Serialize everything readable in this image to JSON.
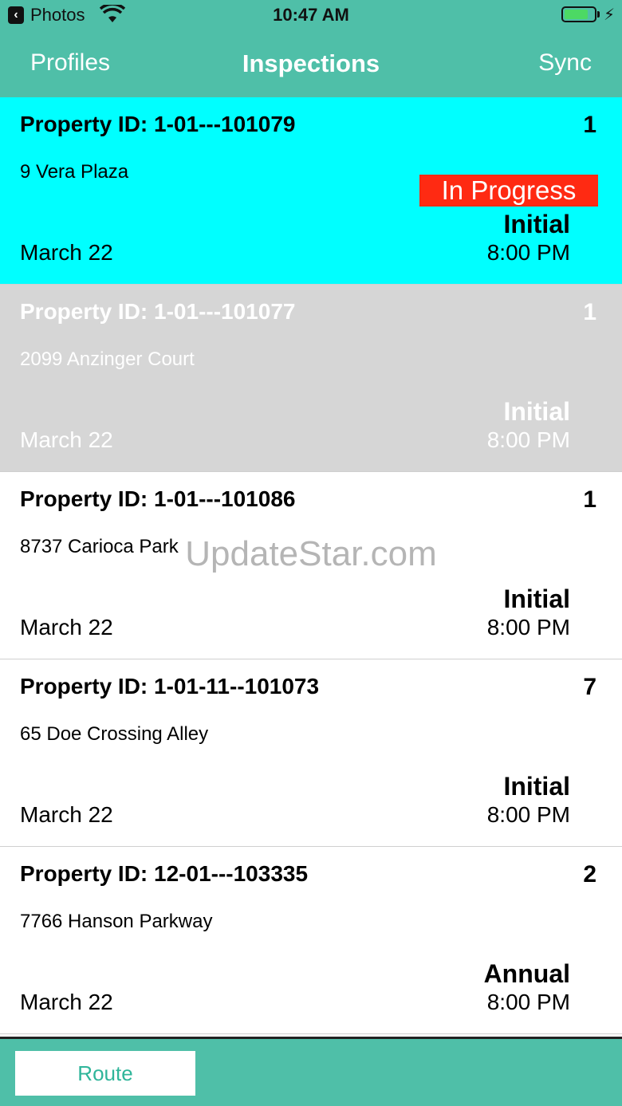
{
  "status_bar": {
    "back_app": "Photos",
    "time": "10:47 AM",
    "battery_level": 0.8,
    "icons": [
      "wifi-icon",
      "battery-icon",
      "charging-bolt-icon"
    ]
  },
  "nav": {
    "left": "Profiles",
    "title": "Inspections",
    "right": "Sync"
  },
  "rows": [
    {
      "pid": "Property ID: 1-01---101079",
      "count": "1",
      "address": "9 Vera Plaza",
      "status": "In Progress",
      "kind": "Initial",
      "date": "March 22",
      "time": "8:00 PM",
      "state": "active"
    },
    {
      "pid": "Property ID: 1-01---101077",
      "count": "1",
      "address": "2099 Anzinger Court",
      "status": "",
      "kind": "Initial",
      "date": "March 22",
      "time": "8:00 PM",
      "state": "dim"
    },
    {
      "pid": "Property ID: 1-01---101086",
      "count": "1",
      "address": "8737 Carioca Park",
      "status": "",
      "kind": "Initial",
      "date": "March 22",
      "time": "8:00 PM",
      "state": "normal"
    },
    {
      "pid": "Property ID: 1-01-11--101073",
      "count": "7",
      "address": "65 Doe Crossing Alley",
      "status": "",
      "kind": "Initial",
      "date": "March 22",
      "time": "8:00 PM",
      "state": "normal"
    },
    {
      "pid": "Property ID: 12-01---103335",
      "count": "2",
      "address": "7766 Hanson Parkway",
      "status": "",
      "kind": "Annual",
      "date": "March 22",
      "time": "8:00 PM",
      "state": "normal"
    }
  ],
  "watermark": "UpdateStar.com",
  "toolbar": {
    "route_label": "Route"
  },
  "colors": {
    "accent": "#4fbfa8",
    "active_row": "#00ffff",
    "dim_row": "#d6d6d6",
    "badge": "#ff2a12"
  }
}
